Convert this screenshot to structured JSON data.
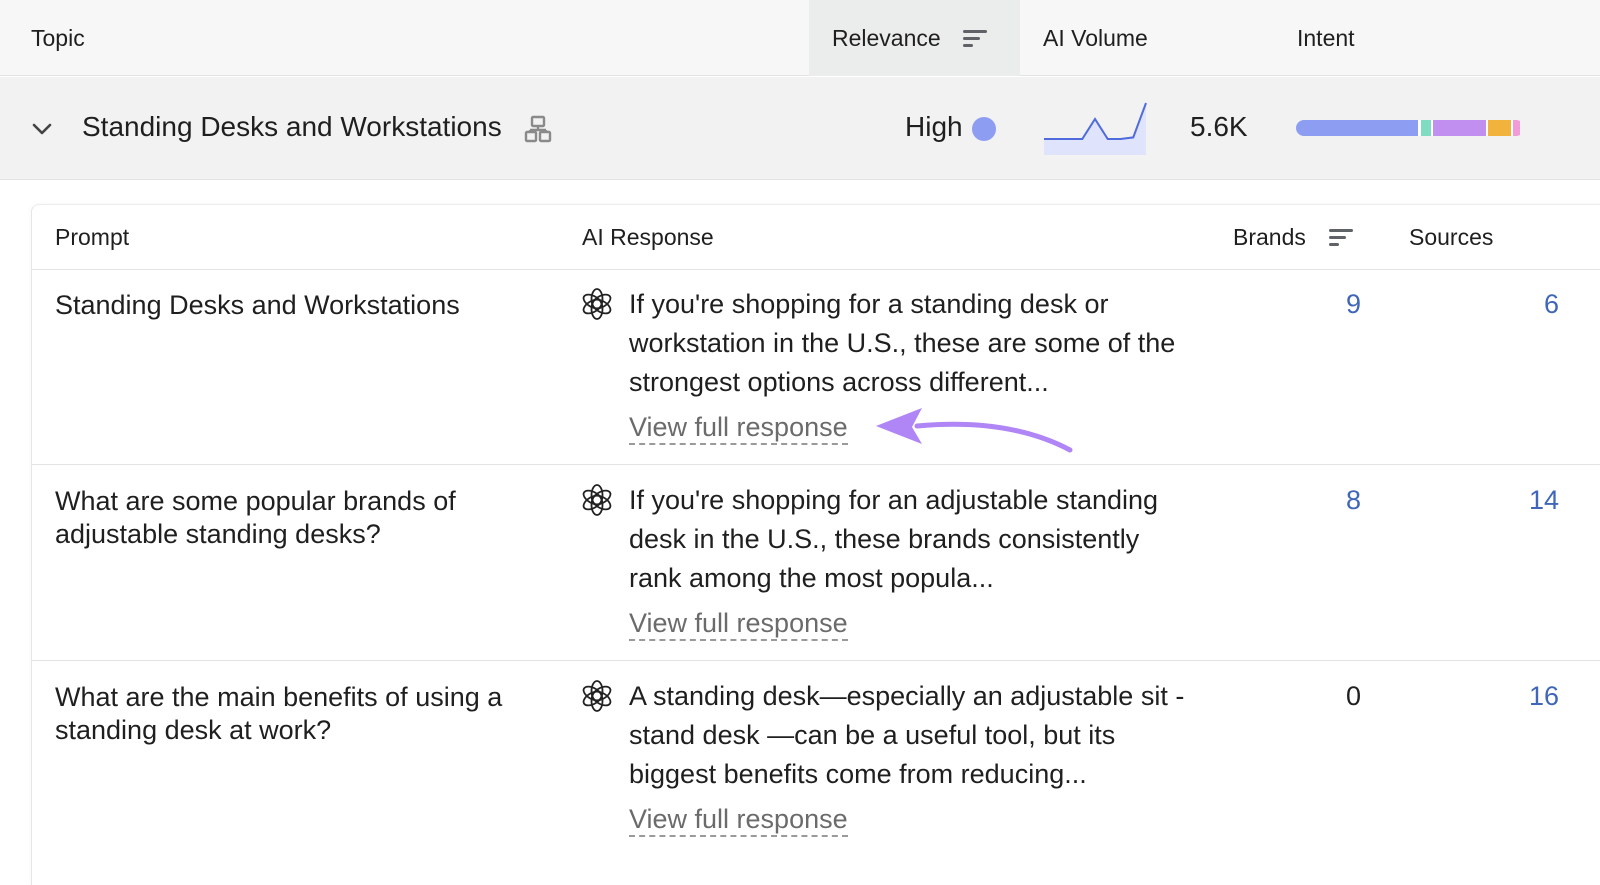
{
  "header": {
    "topic": "Topic",
    "relevance": "Relevance",
    "ai_volume": "AI Volume",
    "intent": "Intent"
  },
  "topic_row": {
    "title": "Standing Desks and Workstations",
    "relevance": "High",
    "relevance_dot_color": "#8d9ef2",
    "volume": "5.6K",
    "volume_trend": [
      1,
      1,
      1,
      1,
      3.5,
      1,
      1,
      1.2,
      5.5
    ],
    "intent_colors": [
      "#8d9ef2",
      "#7fdcc0",
      "#c08ff0",
      "#f2b33d",
      "#f39bd8"
    ]
  },
  "prompt_table": {
    "headers": {
      "prompt": "Prompt",
      "ai_response": "AI Response",
      "brands": "Brands",
      "sources": "Sources"
    },
    "rows": [
      {
        "prompt": "Standing Desks and Workstations",
        "response": "If you're shopping for a standing desk or workstation in the U.S., these are some of the strongest options across different...",
        "link": "View full response",
        "brands": "9",
        "sources": "6"
      },
      {
        "prompt": "What are some popular brands of adjustable standing desks?",
        "response": "If you're shopping for an adjustable standing desk in the U.S., these brands consistently rank among the most popula...",
        "link": "View full response",
        "brands": "8",
        "sources": "14"
      },
      {
        "prompt": "What are the main benefits of using a standing desk at work?",
        "response": "A standing desk—especially an adjustable sit - stand desk —can be a useful tool, but its biggest benefits come from reducing...",
        "link": "View full response",
        "brands": "0",
        "sources": "16"
      }
    ]
  },
  "annotation_color": "#b085f5"
}
